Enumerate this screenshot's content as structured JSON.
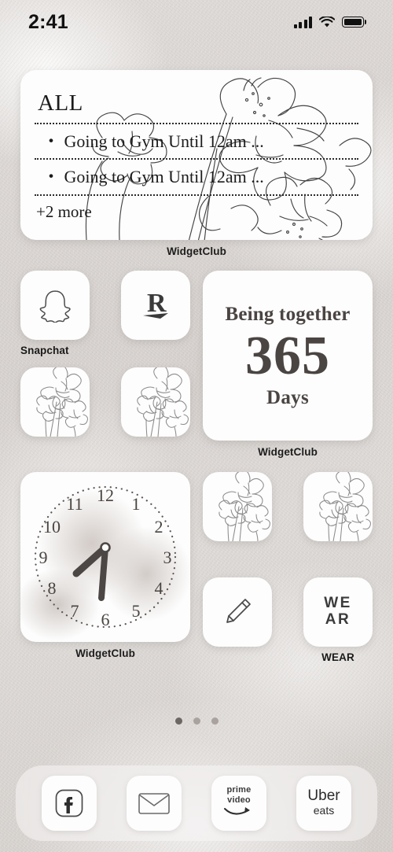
{
  "status_bar": {
    "time": "2:41",
    "signal_icon": "cellular-bars-icon",
    "wifi_icon": "wifi-icon",
    "battery_icon": "battery-full-icon"
  },
  "reminders_widget": {
    "title": "ALL",
    "items": [
      "Going to Gym Until 12am ...",
      "Going to Gym Until 12am ..."
    ],
    "bullet": "・",
    "more": "+2 more",
    "label": "WidgetClub"
  },
  "row_apps_1": [
    {
      "name": "snapchat",
      "icon": "snapchat-ghost-icon",
      "label": "Snapchat"
    },
    {
      "name": "rakuten",
      "icon": "rakuten-r-icon",
      "label": ""
    }
  ],
  "row_apps_2": [
    {
      "name": "flower-app-1",
      "icon": "flower-sketch-icon",
      "label": ""
    },
    {
      "name": "flower-app-2",
      "icon": "flower-sketch-icon",
      "label": ""
    }
  ],
  "anniversary_widget": {
    "heading": "Being together",
    "count": "365",
    "unit": "Days",
    "label": "WidgetClub"
  },
  "clock_widget": {
    "numbers": [
      "12",
      "1",
      "2",
      "3",
      "4",
      "5",
      "6",
      "7",
      "8",
      "9",
      "10",
      "11"
    ],
    "label": "WidgetClub",
    "hour_hand_deg": 222,
    "minute_hand_deg": 185
  },
  "row_apps_3": [
    {
      "name": "flower-app-3",
      "icon": "flower-sketch-icon",
      "label": ""
    },
    {
      "name": "flower-app-4",
      "icon": "flower-sketch-icon",
      "label": ""
    }
  ],
  "row_apps_4": [
    {
      "name": "notes",
      "icon": "pencil-icon",
      "label": ""
    },
    {
      "name": "wear",
      "icon": "wear-text-icon",
      "label": "WEAR",
      "icon_line_1": "WE",
      "icon_line_2": "AR"
    }
  ],
  "page_dots": {
    "count": 3,
    "active_index": 0
  },
  "dock": [
    {
      "name": "facebook",
      "icon": "facebook-f-icon",
      "label": ""
    },
    {
      "name": "mail",
      "icon": "envelope-icon",
      "label": ""
    },
    {
      "name": "prime-video",
      "icon": "prime-video-icon",
      "line_1": "prime",
      "line_2": "video"
    },
    {
      "name": "uber-eats",
      "icon": "uber-eats-icon",
      "line_1": "Uber",
      "line_2": "eats"
    }
  ],
  "colors": {
    "wallpaper": "#d7d3d0",
    "card": "#fdfdfd",
    "ink": "#1b1b1b",
    "widget_text": "#4a4442",
    "dot_active": "#6d6764",
    "dot_inactive": "#a9a29e"
  }
}
